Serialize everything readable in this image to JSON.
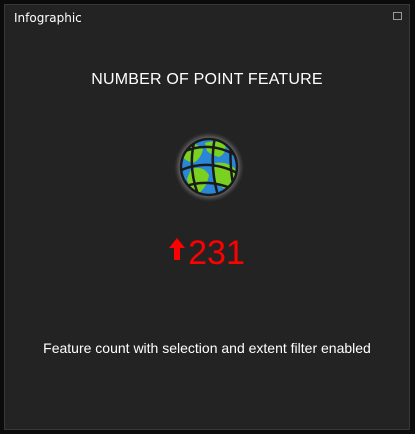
{
  "window": {
    "title": "Infographic"
  },
  "infographic": {
    "heading": "NUMBER OF POINT FEATURE",
    "count": "231",
    "trend_icon": "arrow-up-icon",
    "icon": "globe-icon",
    "footer": "Feature count with selection and extent filter enabled"
  },
  "colors": {
    "background": "#232323",
    "count": "#ff0000",
    "text": "#ffffff"
  }
}
